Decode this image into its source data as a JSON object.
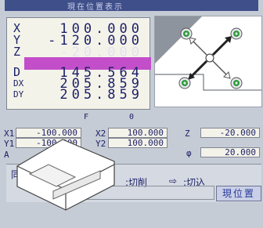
{
  "title": "現在位置表示",
  "coords": [
    {
      "label": "X",
      "value": " 100.000"
    },
    {
      "label": "Y",
      "value": "-120.000"
    },
    {
      "label": "Z",
      "value": " -20.000"
    }
  ],
  "stats": [
    {
      "label": "D",
      "value": "145.564"
    },
    {
      "label": "DX",
      "value": "205.859"
    },
    {
      "label": "DY",
      "value": "205.859"
    }
  ],
  "feed": {
    "label": "F",
    "value": "0"
  },
  "fields": {
    "x1": {
      "label": "X1",
      "value": "-100.000"
    },
    "y1": {
      "label": "Y1",
      "value": "-100.000"
    },
    "a": {
      "label": "A",
      "value": ""
    },
    "x2": {
      "label": "X2",
      "value": "100.000"
    },
    "y2": {
      "label": "Y2",
      "value": "100.000"
    },
    "z": {
      "label": "Z",
      "value": "-20.000"
    },
    "phi": {
      "label": "φ",
      "value": "20.000"
    }
  },
  "bottom": {
    "mode_label": "同期",
    "cut_text": ":切削",
    "arrow": "⇨",
    "feed_text": ":切込",
    "position_button": "現位置"
  },
  "colors": {
    "highlight": "#c24fc9",
    "accent_green": "#2f9a3a",
    "screen_bg": "#c6ccd6"
  }
}
